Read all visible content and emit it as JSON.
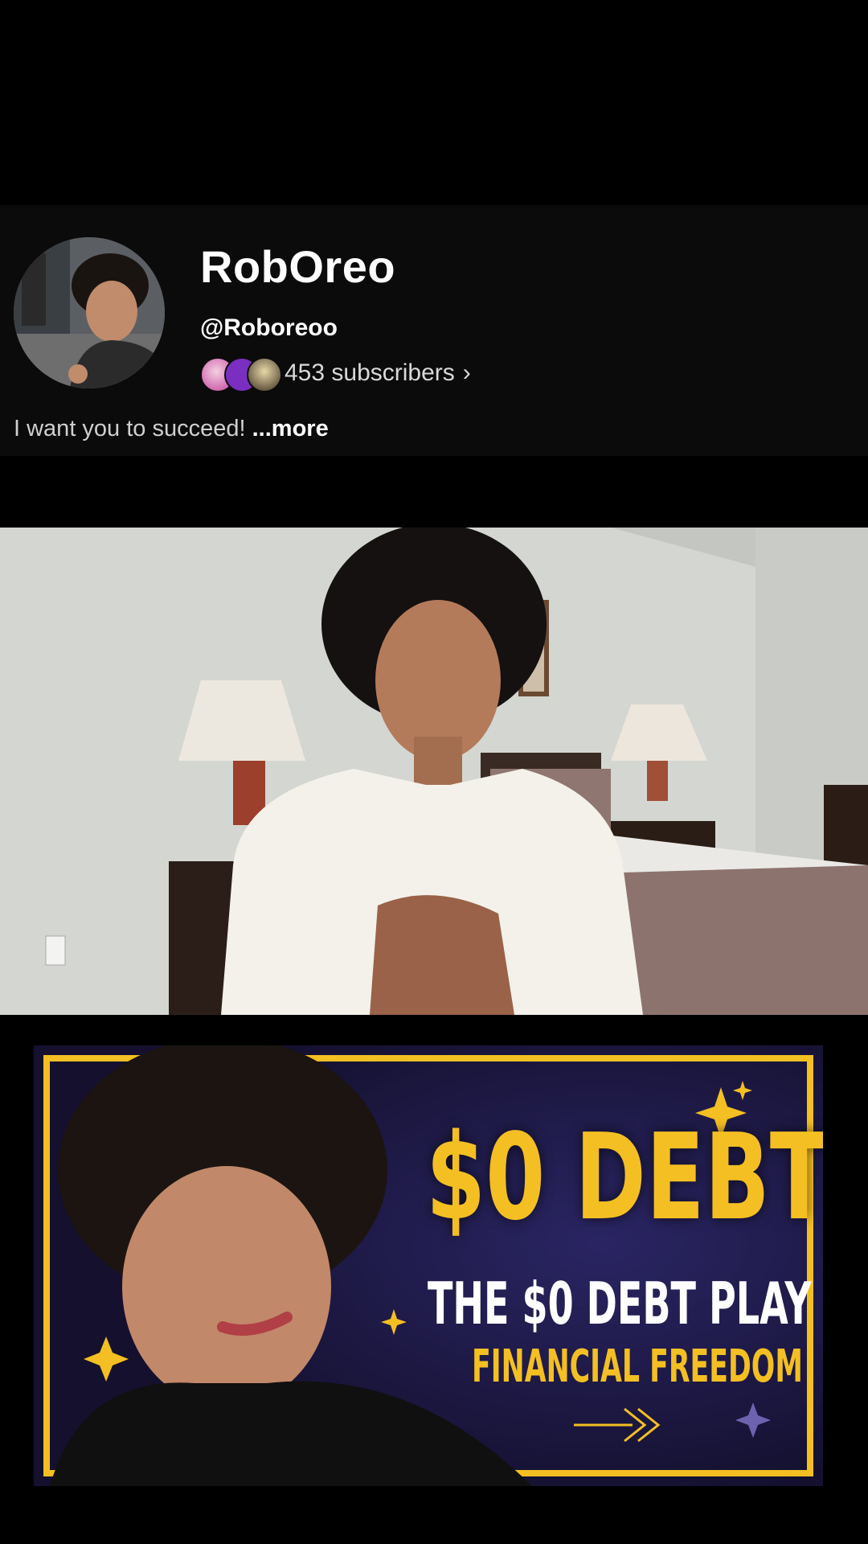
{
  "channel": {
    "name": "RobOreo",
    "handle": "@Roboreoo",
    "subscribers": "453 subscribers",
    "chevron": "›",
    "bio": "I want you to succeed!",
    "bio_more": "...more"
  },
  "video": {
    "icon": "video-frame"
  },
  "thumbnail": {
    "headline": "$0 DEBT",
    "subtitle": "THE $0 DEBT PLAY",
    "tagline": "FINANCIAL FREEDOM"
  },
  "colors": {
    "accent_gold": "#f4bf22",
    "thumb_bg": "#1e1a4a",
    "card_bg": "#0b0b0b"
  }
}
